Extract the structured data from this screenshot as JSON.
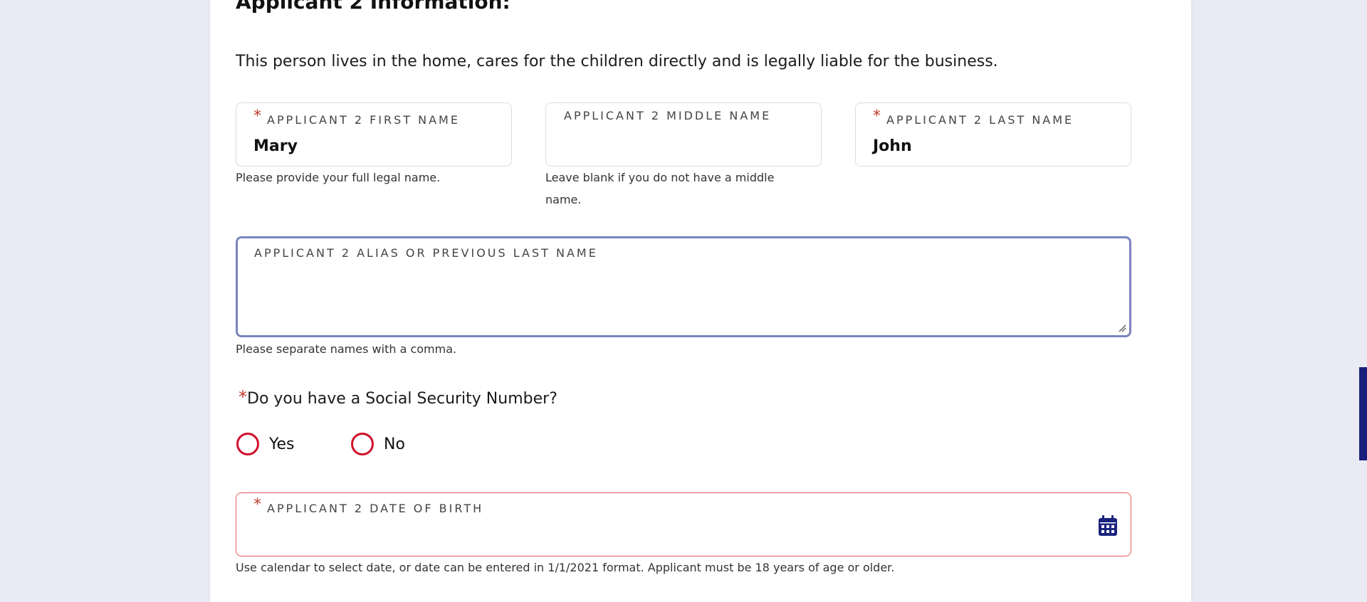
{
  "section": {
    "title": "Applicant 2 Information:",
    "intro": "This person lives in the home, cares for the children directly and is legally liable for the business."
  },
  "fields": {
    "first_name": {
      "label": "APPLICANT 2 FIRST NAME",
      "value": "Mary",
      "help": "Please provide your full legal name.",
      "required": true
    },
    "middle_name": {
      "label": "APPLICANT 2 MIDDLE NAME",
      "value": "",
      "help_line1": "Leave blank if you do not have a middle",
      "help_line2": "name.",
      "required": false
    },
    "last_name": {
      "label": "APPLICANT 2 LAST NAME",
      "value": "John",
      "required": true
    },
    "alias": {
      "label": "APPLICANT 2 ALIAS OR PREVIOUS LAST NAME",
      "value": "",
      "help": "Please separate names with a comma."
    },
    "ssn_question": {
      "required_mark": "*",
      "text": "Do you have a Social Security Number?",
      "options": [
        "Yes",
        "No"
      ]
    },
    "dob": {
      "label": "APPLICANT 2 DATE OF BIRTH",
      "value": "",
      "help": "Use calendar to select date, or date can be entered in 1/1/2021 format. Applicant must be 18 years of age or older.",
      "icon": "calendar-icon",
      "required": true
    }
  },
  "required_mark": "*",
  "colors": {
    "background": "#eaeaf5",
    "required": "#c0392b",
    "radio_border": "#d0112b",
    "focus_border": "#7b84bd",
    "error_border": "#e35b5b",
    "icon": "#1a237e"
  }
}
